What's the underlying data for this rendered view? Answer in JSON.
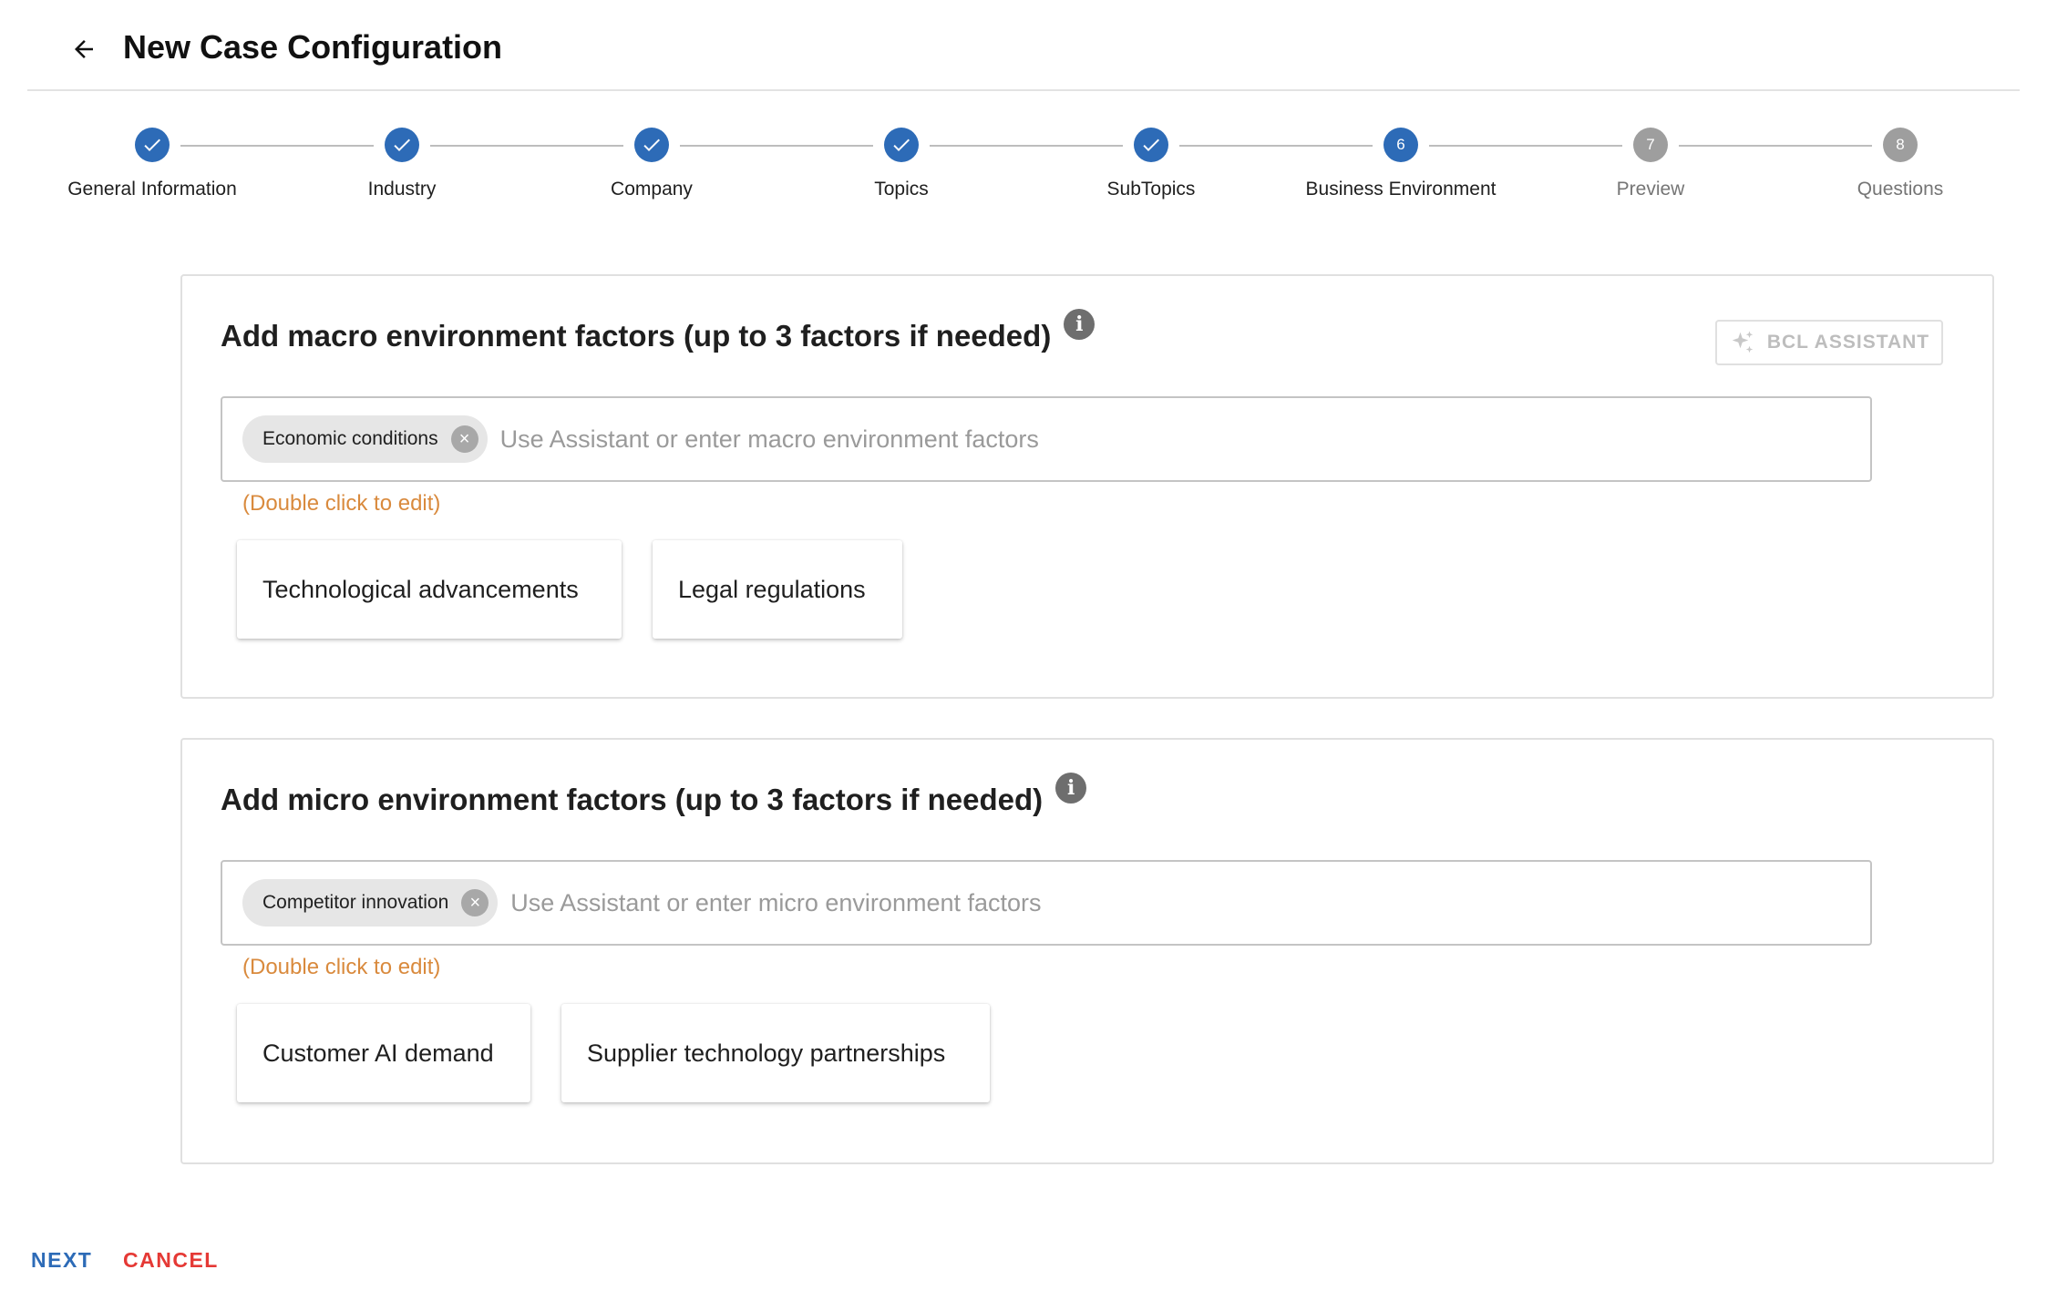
{
  "header": {
    "back_icon": "arrow-left-icon",
    "title": "New Case Configuration"
  },
  "stepper": {
    "steps": [
      {
        "label": "General Information",
        "status": "done",
        "number": "1"
      },
      {
        "label": "Industry",
        "status": "done",
        "number": "2"
      },
      {
        "label": "Company",
        "status": "done",
        "number": "3"
      },
      {
        "label": "Topics",
        "status": "done",
        "number": "4"
      },
      {
        "label": "SubTopics",
        "status": "done",
        "number": "5"
      },
      {
        "label": "Business Environment",
        "status": "active",
        "number": "6"
      },
      {
        "label": "Preview",
        "status": "todo",
        "number": "7"
      },
      {
        "label": "Questions",
        "status": "todo",
        "number": "8"
      }
    ]
  },
  "macro": {
    "title": "Add macro environment factors (up to 3 factors if needed)",
    "info_icon": "info-icon",
    "assistant_label": "BCL ASSISTANT",
    "assistant_icon": "sparkle-icon",
    "chip": "Economic conditions",
    "placeholder": "Use Assistant or enter macro environment factors",
    "hint": "(Double click to edit)",
    "suggestions": [
      "Technological advancements",
      "Legal regulations"
    ]
  },
  "micro": {
    "title": "Add micro environment factors (up to 3 factors if needed)",
    "info_icon": "info-icon",
    "chip": "Competitor innovation",
    "placeholder": "Use Assistant or enter micro environment factors",
    "hint": "(Double click to edit)",
    "suggestions": [
      "Customer AI demand",
      "Supplier technology partnerships"
    ]
  },
  "footer": {
    "next_label": "NEXT",
    "cancel_label": "CANCEL"
  },
  "colors": {
    "primary": "#2d6bb7",
    "inactive_step": "#9e9e9e",
    "hint": "#d98a3d",
    "cancel": "#e53935"
  }
}
